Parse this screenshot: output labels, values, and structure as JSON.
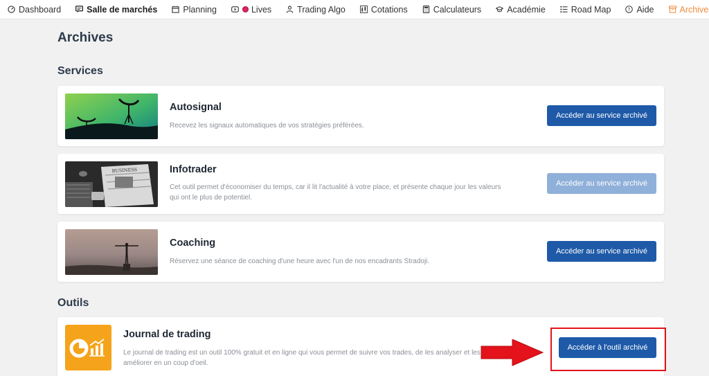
{
  "nav": {
    "items": [
      {
        "label": "Dashboard",
        "icon": "dashboard-icon"
      },
      {
        "label": "Salle de marchés",
        "icon": "chat-icon"
      },
      {
        "label": "Planning",
        "icon": "calendar-icon"
      },
      {
        "label": "Lives",
        "icon": "play-icon"
      },
      {
        "label": "Trading Algo",
        "icon": "robot-icon"
      },
      {
        "label": "Cotations",
        "icon": "candles-icon"
      },
      {
        "label": "Calculateurs",
        "icon": "calculator-icon"
      },
      {
        "label": "Académie",
        "icon": "graduation-cap-icon"
      },
      {
        "label": "Road Map",
        "icon": "list-icon"
      },
      {
        "label": "Aide",
        "icon": "help-icon"
      },
      {
        "label": "Archives",
        "icon": "archive-icon"
      }
    ],
    "active_color": "#f08a3c"
  },
  "page": {
    "title": "Archives",
    "services_heading": "Services",
    "tools_heading": "Outils"
  },
  "services": [
    {
      "title": "Autosignal",
      "description": "Recevez les signaux automatiques de vos stratégies préférées.",
      "button": "Accéder au service archivé"
    },
    {
      "title": "Infotrader",
      "description": "Cet outil permet d'économiser du temps, car il lit l'actualité à votre place, et présente chaque jour les valeurs qui ont le plus de potentiel.",
      "button": "Accéder au service archivé",
      "newspaper_text": "BUSINESS"
    },
    {
      "title": "Coaching",
      "description": "Réservez une séance de coaching d'une heure avec l'un de nos encadrants Stradoji.",
      "button": "Accéder au service archivé"
    }
  ],
  "tools": [
    {
      "title": "Journal de trading",
      "description": "Le journal de trading est un outil 100% gratuit et en ligne qui vous permet de suivre vos trades, de les analyser et les améliorer en un coup d'oeil.",
      "button": "Accéder à l'outil archivé"
    }
  ],
  "colors": {
    "primary_button": "#1e5aa8",
    "disabled_button": "#8fb0d9",
    "annotation_red": "#e3121b",
    "journal_orange": "#f5a31a"
  }
}
